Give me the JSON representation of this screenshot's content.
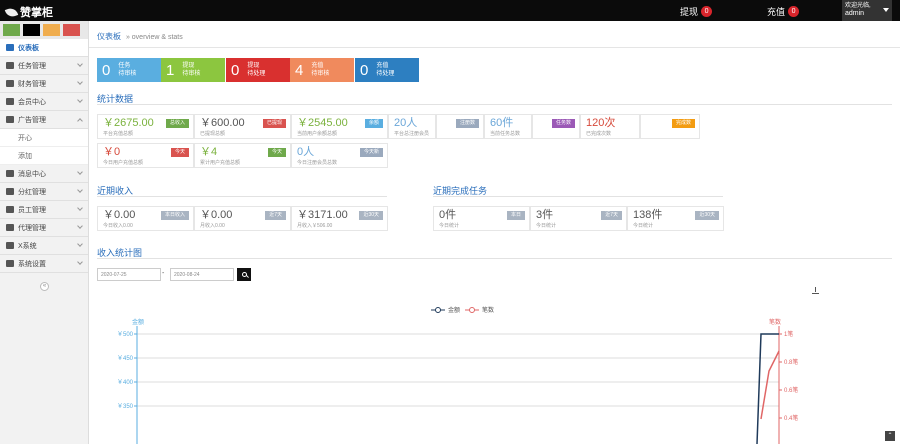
{
  "header": {
    "app_name": "赞掌柜",
    "withdraw_label": "提现",
    "withdraw_count": "0",
    "recharge_label": "充值",
    "recharge_count": "0",
    "welcome": "欢迎光临,",
    "username": "admin"
  },
  "sidebar": {
    "shortcut_colors": [
      "#6fa94b",
      "#000000",
      "#f0ad4e",
      "#d9534f"
    ],
    "items": [
      {
        "label": "仪表板",
        "active": true
      },
      {
        "label": "任务管理"
      },
      {
        "label": "财务管理"
      },
      {
        "label": "会员中心"
      },
      {
        "label": "广告管理",
        "open": true
      },
      {
        "label": "开心"
      },
      {
        "label": "添加"
      },
      {
        "label": "消息中心"
      },
      {
        "label": "分红管理"
      },
      {
        "label": "员工管理"
      },
      {
        "label": "代理管理"
      },
      {
        "label": "X系统"
      },
      {
        "label": "系统设置"
      }
    ]
  },
  "breadcrumb": {
    "title": "仪表板",
    "subtitle": "» overview & stats"
  },
  "tiles": [
    {
      "num": "0",
      "line1": "任务",
      "line2": "待审核",
      "color": "#5aaee0"
    },
    {
      "num": "1",
      "line1": "提现",
      "line2": "待审核",
      "color": "#8cc63f"
    },
    {
      "num": "0",
      "line1": "提现",
      "line2": "待处理",
      "color": "#d9302f"
    },
    {
      "num": "4",
      "line1": "充值",
      "line2": "待审核",
      "color": "#f08a5d"
    },
    {
      "num": "0",
      "line1": "充值",
      "line2": "待处理",
      "color": "#2d7fc1"
    }
  ],
  "stats": {
    "title": "统计数据",
    "cards": [
      {
        "val": "￥2675.00",
        "sub": "平台充值总额",
        "tag": "总收入",
        "tag_color": "#6fa94b",
        "cls": ""
      },
      {
        "val": "￥600.00",
        "sub": "已提现总额",
        "tag": "已提现",
        "tag_color": "#d9534f",
        "cls": "dark"
      },
      {
        "val": "￥2545.00",
        "sub": "当前用户余额总额",
        "tag": "余额",
        "tag_color": "#5aaee0",
        "cls": ""
      },
      {
        "val": "20人",
        "sub": "平台总注册会员",
        "tag": "",
        "tag_color": "",
        "cls": "blue"
      },
      {
        "val": "",
        "sub": "",
        "tag": "注册数",
        "tag_color": "#9aa9bd",
        "cls": ""
      },
      {
        "val": "60件",
        "sub": "当前任务总数",
        "tag": "",
        "tag_color": "",
        "cls": "blue"
      },
      {
        "val": "",
        "sub": "",
        "tag": "任务数",
        "tag_color": "#9b59b6",
        "cls": ""
      },
      {
        "val": "120次",
        "sub": "已完成次数",
        "tag": "",
        "tag_color": "",
        "cls": "red"
      },
      {
        "val": "",
        "sub": "",
        "tag": "完成数",
        "tag_color": "#f39c12",
        "cls": ""
      }
    ],
    "cards2": [
      {
        "val": "￥0",
        "sub": "今日用户充值总额",
        "tag": "今天",
        "tag_color": "#d9534f",
        "cls": "red"
      },
      {
        "val": "￥4",
        "sub": "累计用户充值总额",
        "tag": "今天",
        "tag_color": "#6fa94b",
        "cls": ""
      },
      {
        "val": "0人",
        "sub": "今日注册会员总数",
        "tag": "今天新",
        "tag_color": "#9aa9bd",
        "cls": "blue"
      }
    ]
  },
  "income": {
    "title": "近期收入",
    "cards": [
      {
        "val": "￥0.00",
        "sub": "今日收入0.00",
        "tag": "本日收入"
      },
      {
        "val": "￥0.00",
        "sub": "月收入0.00",
        "tag": "近7天"
      },
      {
        "val": "￥3171.00",
        "sub": "月收入￥506.00",
        "tag": "近30天"
      }
    ]
  },
  "tasks": {
    "title": "近期完成任务",
    "cards": [
      {
        "val": "0件",
        "sub": "今日统计",
        "tag": "本日"
      },
      {
        "val": "3件",
        "sub": "今日统计",
        "tag": "近7天"
      },
      {
        "val": "138件",
        "sub": "今日统计",
        "tag": "近30天"
      }
    ]
  },
  "chart_section": {
    "title": "收入统计图",
    "date_from": "2020-07-25",
    "date_to": "2020-08-24"
  },
  "chart_data": {
    "type": "line",
    "left_axis_label": "金额",
    "right_axis_label": "笔数",
    "legend": [
      "金额",
      "笔数"
    ],
    "left_ticks": [
      "￥500",
      "￥450",
      "￥400",
      "￥350"
    ],
    "right_ticks": [
      "1笔",
      "0.8笔",
      "0.6笔",
      "0.4笔"
    ],
    "series": [
      {
        "name": "金额",
        "color": "#1f3a5a"
      },
      {
        "name": "笔数",
        "color": "#e06666"
      }
    ]
  },
  "colors": {
    "accent": "#2a6ebb"
  }
}
